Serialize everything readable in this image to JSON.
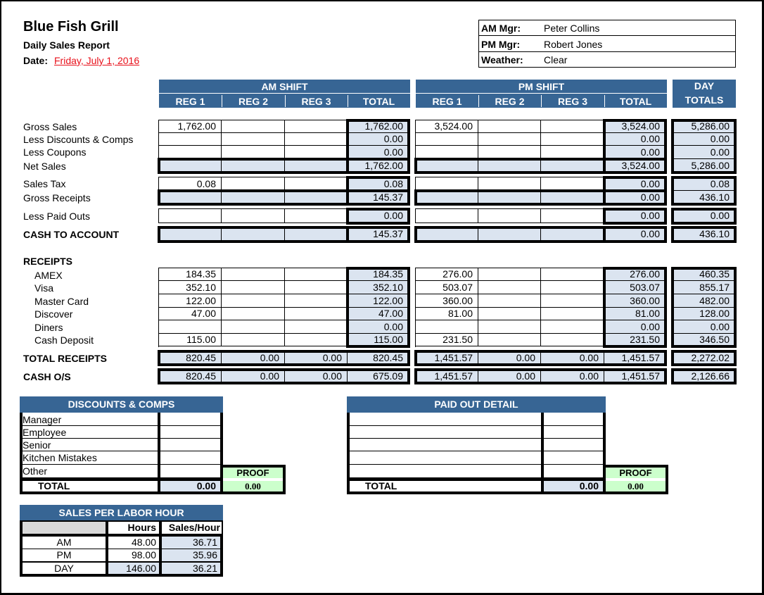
{
  "header": {
    "title": "Blue Fish Grill",
    "subtitle": "Daily Sales Report",
    "date_label": "Date:",
    "date_value": "Friday, July 1, 2016"
  },
  "managers": [
    {
      "label": "AM Mgr:",
      "value": "Peter Collins"
    },
    {
      "label": "PM Mgr:",
      "value": "Robert Jones"
    },
    {
      "label": "Weather:",
      "value": "Clear"
    }
  ],
  "columns": {
    "am_shift": "AM SHIFT",
    "pm_shift": "PM SHIFT",
    "day_line1": "DAY",
    "day_line2": "TOTALS",
    "reg1": "REG 1",
    "reg2": "REG 2",
    "reg3": "REG 3",
    "total": "TOTAL"
  },
  "rows": [
    {
      "label": "Gross Sales",
      "bold": false,
      "indent": false,
      "am": [
        "1,762.00",
        "",
        "",
        "1,762.00"
      ],
      "pm": [
        "3,524.00",
        "",
        "",
        "3,524.00"
      ],
      "day": "5,286.00"
    },
    {
      "label": "Less Discounts & Comps",
      "bold": false,
      "indent": false,
      "am": [
        "",
        "",
        "",
        "0.00"
      ],
      "pm": [
        "",
        "",
        "",
        "0.00"
      ],
      "day": "0.00"
    },
    {
      "label": "Less Coupons",
      "bold": false,
      "indent": false,
      "am": [
        "",
        "",
        "",
        "0.00"
      ],
      "pm": [
        "",
        "",
        "",
        "0.00"
      ],
      "day": "0.00"
    },
    {
      "label": "Net Sales",
      "bold": false,
      "indent": false,
      "am": [
        "",
        "",
        "",
        "1,762.00"
      ],
      "pm": [
        "",
        "",
        "",
        "3,524.00"
      ],
      "day": "5,286.00"
    },
    {
      "label": "Sales Tax",
      "bold": false,
      "indent": false,
      "am": [
        "0.08",
        "",
        "",
        "0.08"
      ],
      "pm": [
        "",
        "",
        "",
        "0.00"
      ],
      "day": "0.08"
    },
    {
      "label": "Gross Receipts",
      "bold": false,
      "indent": false,
      "am": [
        "",
        "",
        "",
        "145.37"
      ],
      "pm": [
        "",
        "",
        "",
        "0.00"
      ],
      "day": "436.10"
    },
    {
      "label": "Less Paid Outs",
      "bold": false,
      "indent": false,
      "am": [
        "",
        "",
        "",
        "0.00"
      ],
      "pm": [
        "",
        "",
        "",
        "0.00"
      ],
      "day": "0.00"
    },
    {
      "label": "CASH TO ACCOUNT",
      "bold": true,
      "indent": false,
      "am": [
        "",
        "",
        "",
        "145.37"
      ],
      "pm": [
        "",
        "",
        "",
        "0.00"
      ],
      "day": "436.10"
    }
  ],
  "receipts_heading": "RECEIPTS",
  "receipts": [
    {
      "label": "AMEX",
      "am": [
        "184.35",
        "",
        "",
        "184.35"
      ],
      "pm": [
        "276.00",
        "",
        "",
        "276.00"
      ],
      "day": "460.35"
    },
    {
      "label": "Visa",
      "am": [
        "352.10",
        "",
        "",
        "352.10"
      ],
      "pm": [
        "503.07",
        "",
        "",
        "503.07"
      ],
      "day": "855.17"
    },
    {
      "label": "Master Card",
      "am": [
        "122.00",
        "",
        "",
        "122.00"
      ],
      "pm": [
        "360.00",
        "",
        "",
        "360.00"
      ],
      "day": "482.00"
    },
    {
      "label": "Discover",
      "am": [
        "47.00",
        "",
        "",
        "47.00"
      ],
      "pm": [
        "81.00",
        "",
        "",
        "81.00"
      ],
      "day": "128.00"
    },
    {
      "label": "Diners",
      "am": [
        "",
        "",
        "",
        "0.00"
      ],
      "pm": [
        "",
        "",
        "",
        "0.00"
      ],
      "day": "0.00"
    },
    {
      "label": "Cash Deposit",
      "am": [
        "115.00",
        "",
        "",
        "115.00"
      ],
      "pm": [
        "231.50",
        "",
        "",
        "231.50"
      ],
      "day": "346.50"
    }
  ],
  "totals": [
    {
      "label": "TOTAL RECEIPTS",
      "am": [
        "820.45",
        "0.00",
        "0.00",
        "820.45"
      ],
      "pm": [
        "1,451.57",
        "0.00",
        "0.00",
        "1,451.57"
      ],
      "day": "2,272.02"
    },
    {
      "label": "CASH O/S",
      "am": [
        "820.45",
        "0.00",
        "0.00",
        "675.09"
      ],
      "pm": [
        "1,451.57",
        "0.00",
        "0.00",
        "1,451.57"
      ],
      "day": "2,126.66"
    }
  ],
  "discounts": {
    "title": "DISCOUNTS & COMPS",
    "items": [
      {
        "label": "Manager",
        "value": ""
      },
      {
        "label": "Employee",
        "value": ""
      },
      {
        "label": "Senior",
        "value": ""
      },
      {
        "label": "Kitchen Mistakes",
        "value": ""
      },
      {
        "label": "Other",
        "value": ""
      }
    ],
    "total_label": "TOTAL",
    "total_value": "0.00",
    "proof_label": "PROOF",
    "proof_value": "0.00"
  },
  "paid_out": {
    "title": "PAID OUT DETAIL",
    "items": [
      {
        "label": "",
        "value": ""
      },
      {
        "label": "",
        "value": ""
      },
      {
        "label": "",
        "value": ""
      },
      {
        "label": "",
        "value": ""
      },
      {
        "label": "",
        "value": ""
      }
    ],
    "total_label": "TOTAL",
    "total_value": "0.00",
    "proof_label": "PROOF",
    "proof_value": "0.00"
  },
  "labor": {
    "title": "SALES PER LABOR HOUR",
    "col_hours": "Hours",
    "col_sales_hour": "Sales/Hour",
    "rows": [
      {
        "label": "AM",
        "hours": "48.00",
        "sales_hour": "36.71"
      },
      {
        "label": "PM",
        "hours": "98.00",
        "sales_hour": "35.96"
      },
      {
        "label": "DAY",
        "hours": "146.00",
        "sales_hour": "36.21"
      }
    ]
  },
  "colors": {
    "header_blue": "#376594",
    "calc_fill": "#dbe4f0",
    "proof_green": "#ccffcc",
    "date_red": "#e8111b"
  }
}
